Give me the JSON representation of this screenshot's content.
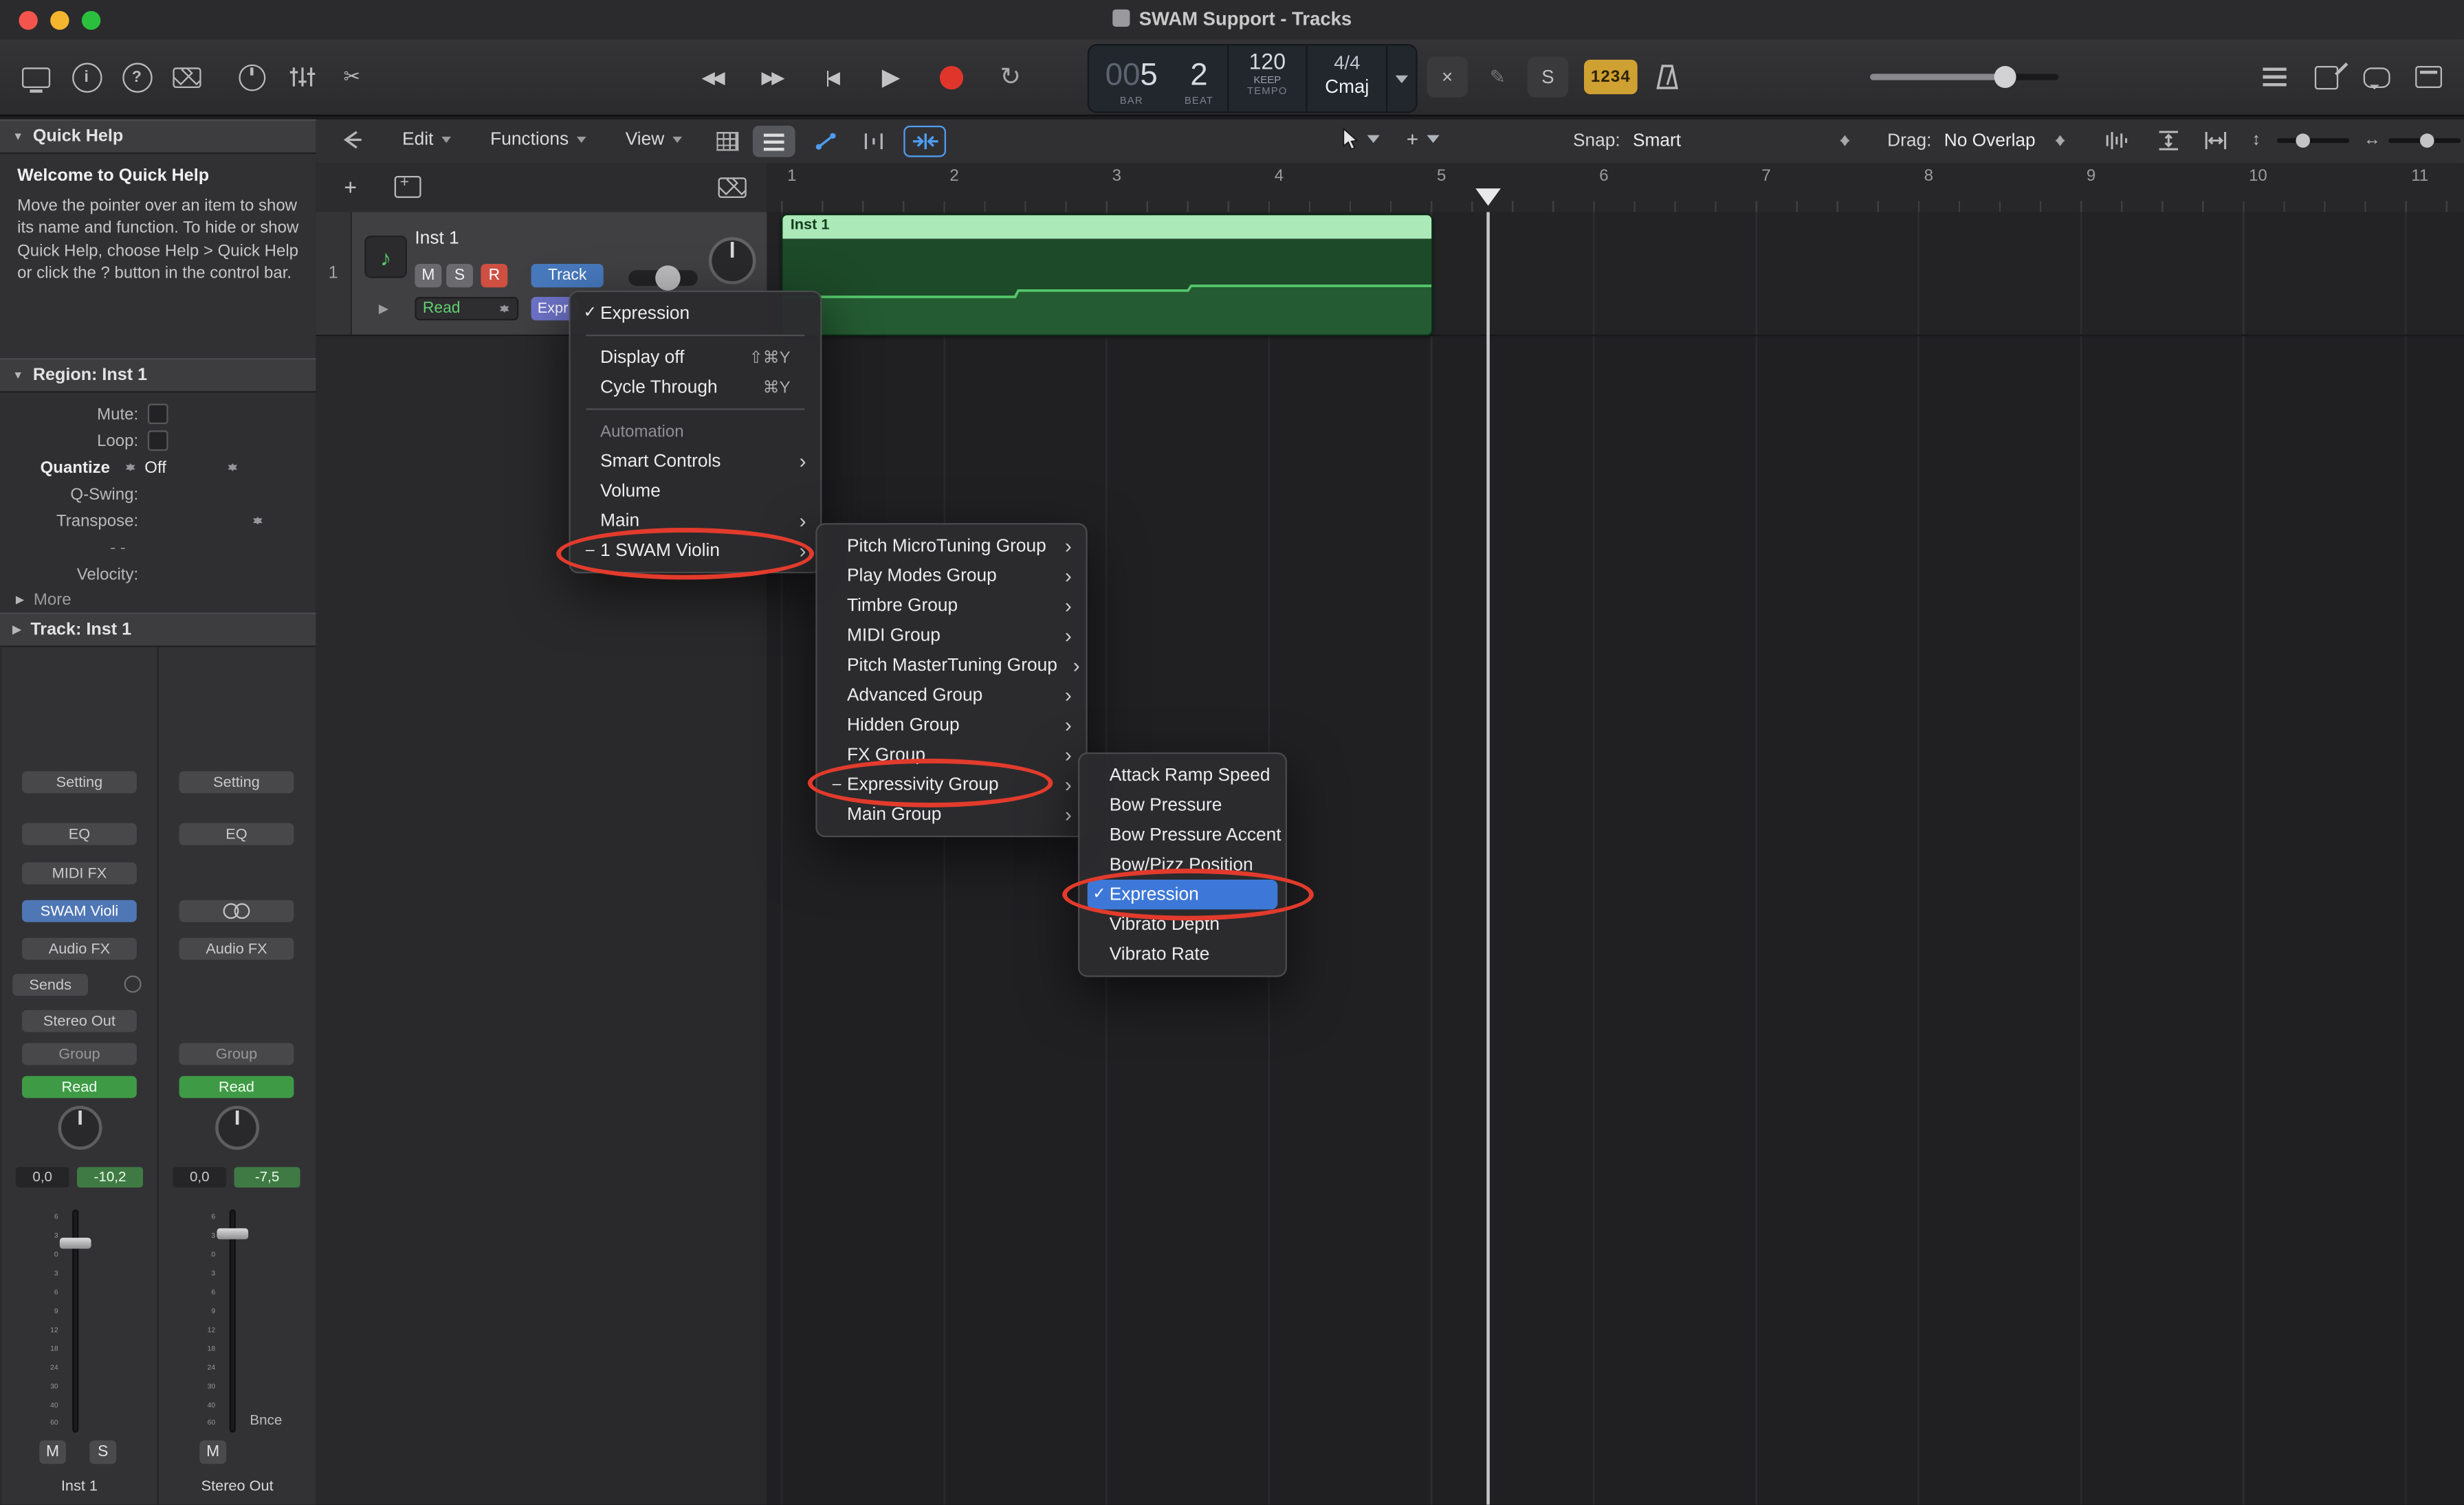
{
  "window": {
    "title": "SWAM Support - Tracks"
  },
  "icons": {
    "down": "▼",
    "right": "▶",
    "submenu": "›",
    "info": "i",
    "help": "?",
    "rewind": "◀◀",
    "forward": "▶▶",
    "go_begin": "|◀",
    "play": "▶",
    "cycle": "↻",
    "editors": "✂",
    "pencil": "✎",
    "note": "♪",
    "plus": "+",
    "vzoom": "↕",
    "hzoom": "↔"
  },
  "toolbar": {
    "no_input": "×",
    "solo": "S",
    "count_in": "1234"
  },
  "lcd": {
    "bar_prefix": "00",
    "bar": "5",
    "beat": "2",
    "bar_label": "BAR",
    "beat_label": "BEAT",
    "tempo": "120",
    "tempo_mode": "KEEP",
    "tempo_label": "TEMPO",
    "time_sig": "4/4",
    "key": "Cmaj"
  },
  "tracks_toolbar": {
    "edit": "Edit",
    "functions": "Functions",
    "view": "View",
    "snap_label": "Snap:",
    "snap_value": "Smart",
    "drag_label": "Drag:",
    "drag_value": "No Overlap"
  },
  "quick_help": {
    "title": "Quick Help",
    "heading": "Welcome to Quick Help",
    "body": "Move the pointer over an item to show its name and function. To hide or show Quick Help, choose Help > Quick Help or click the ? button in the control bar."
  },
  "region_inspector": {
    "title": "Region: Inst 1",
    "rows": [
      {
        "label": "Mute:"
      },
      {
        "label": "Loop:"
      },
      {
        "label": "Quantize",
        "value": "Off"
      },
      {
        "label": "Q-Swing:"
      },
      {
        "label": "Transpose:"
      },
      {
        "value": "- -"
      },
      {
        "label": "Velocity:"
      }
    ],
    "more": "More"
  },
  "track_inspector": {
    "title": "Track:  Inst 1"
  },
  "strips": {
    "left": {
      "setting": "Setting",
      "eq": "EQ",
      "midi_fx": "MIDI FX",
      "instrument": "SWAM Violi",
      "audio_fx": "Audio FX",
      "sends": "Sends",
      "output": "Stereo Out",
      "group": "Group",
      "automation": "Read",
      "pan": "0,0",
      "volume": "-10,2",
      "mute": "M",
      "solo": "S",
      "name": "Inst 1"
    },
    "right": {
      "setting": "Setting",
      "eq": "EQ",
      "audio_fx": "Audio FX",
      "group": "Group",
      "automation": "Read",
      "pan": "0,0",
      "volume": "-7,5",
      "mute": "M",
      "bounce": "Bnce",
      "name": "Stereo Out"
    }
  },
  "fader_ticks": [
    "6",
    "3",
    "0",
    "3",
    "6",
    "9",
    "12",
    "18",
    "24",
    "30",
    "40",
    "60"
  ],
  "track_header": {
    "num": "1",
    "name": "Inst 1",
    "mute": "M",
    "solo": "S",
    "record": "R",
    "track_button": "Track",
    "automation_mode": "Read",
    "param": "Expr"
  },
  "ruler": {
    "bars": [
      "1",
      "2",
      "3",
      "4",
      "5",
      "6",
      "7",
      "8",
      "9",
      "10",
      "11"
    ]
  },
  "arrangement": {
    "region_name": "Inst 1"
  },
  "menus": {
    "automation": {
      "items": [
        {
          "check": "✓",
          "label": "Expression"
        },
        {
          "type": "sep"
        },
        {
          "label": "Display off",
          "shortcut": "⇧⌘Y"
        },
        {
          "label": "Cycle Through",
          "shortcut": "⌘Y"
        },
        {
          "type": "sep"
        },
        {
          "type": "header",
          "label": "Automation"
        },
        {
          "label": "Smart Controls",
          "arrow": "›"
        },
        {
          "label": "Volume"
        },
        {
          "label": "Main",
          "arrow": "›"
        },
        {
          "check": "–",
          "label": "1 SWAM Violin",
          "arrow": "›"
        }
      ]
    },
    "groups": {
      "items": [
        {
          "label": "Pitch MicroTuning Group",
          "arrow": "›"
        },
        {
          "label": "Play Modes Group",
          "arrow": "›"
        },
        {
          "label": "Timbre Group",
          "arrow": "›"
        },
        {
          "label": "MIDI Group",
          "arrow": "›"
        },
        {
          "label": "Pitch MasterTuning Group",
          "arrow": "›"
        },
        {
          "label": "Advanced Group",
          "arrow": "›"
        },
        {
          "label": "Hidden Group",
          "arrow": "›"
        },
        {
          "label": "FX Group",
          "arrow": "›"
        },
        {
          "check": "–",
          "label": "Expressivity Group",
          "arrow": "›"
        },
        {
          "label": "Main Group",
          "arrow": "›"
        }
      ]
    },
    "params": {
      "items": [
        {
          "label": "Attack Ramp Speed"
        },
        {
          "label": "Bow Pressure"
        },
        {
          "label": "Bow Pressure Accent"
        },
        {
          "label": "Bow/Pizz Position"
        },
        {
          "check": "✓",
          "label": "Expression",
          "cls": "selected"
        },
        {
          "label": "Vibrato Depth"
        },
        {
          "label": "Vibrato Rate"
        }
      ]
    }
  },
  "colors": {
    "annotation": "#e23b2c",
    "accent_blue": "#3d78d8",
    "record_red": "#e0352b",
    "region_header_green": "#ace9b8",
    "region_body_green": "#1d4a29",
    "count_in_amber": "#cfa032"
  }
}
